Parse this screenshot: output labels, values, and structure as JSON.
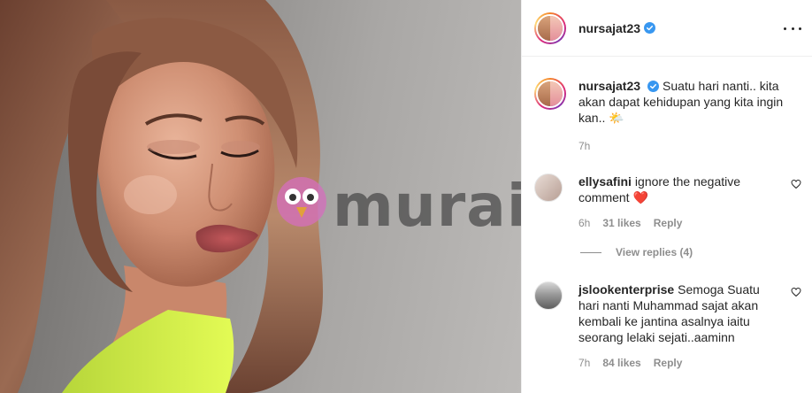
{
  "watermark": {
    "text": "murai"
  },
  "header": {
    "username": "nursajat23",
    "verified": true,
    "more": "more-horizontal-icon"
  },
  "caption": {
    "username": "nursajat23",
    "text": "Suatu hari nanti.. kita akan dapat kehidupan yang kita ingin kan.. 🌤️",
    "time": "7h"
  },
  "comments": [
    {
      "username": "ellysafini",
      "text": "ignore the negative comment ❤️",
      "time": "6h",
      "likes": "31 likes",
      "reply": "Reply",
      "view_replies": "View replies (4)"
    },
    {
      "username": "jslookenterprise",
      "text": "Semoga Suatu hari nanti Muhammad sajat akan kembali ke jantina asalnya iaitu seorang lelaki sejati..aaminn",
      "time": "7h",
      "likes": "84 likes",
      "reply": "Reply"
    }
  ],
  "colors": {
    "verified": "#3897f0",
    "muted": "#8e8e8e",
    "text": "#262626",
    "accent_top": "#d6f54a"
  }
}
